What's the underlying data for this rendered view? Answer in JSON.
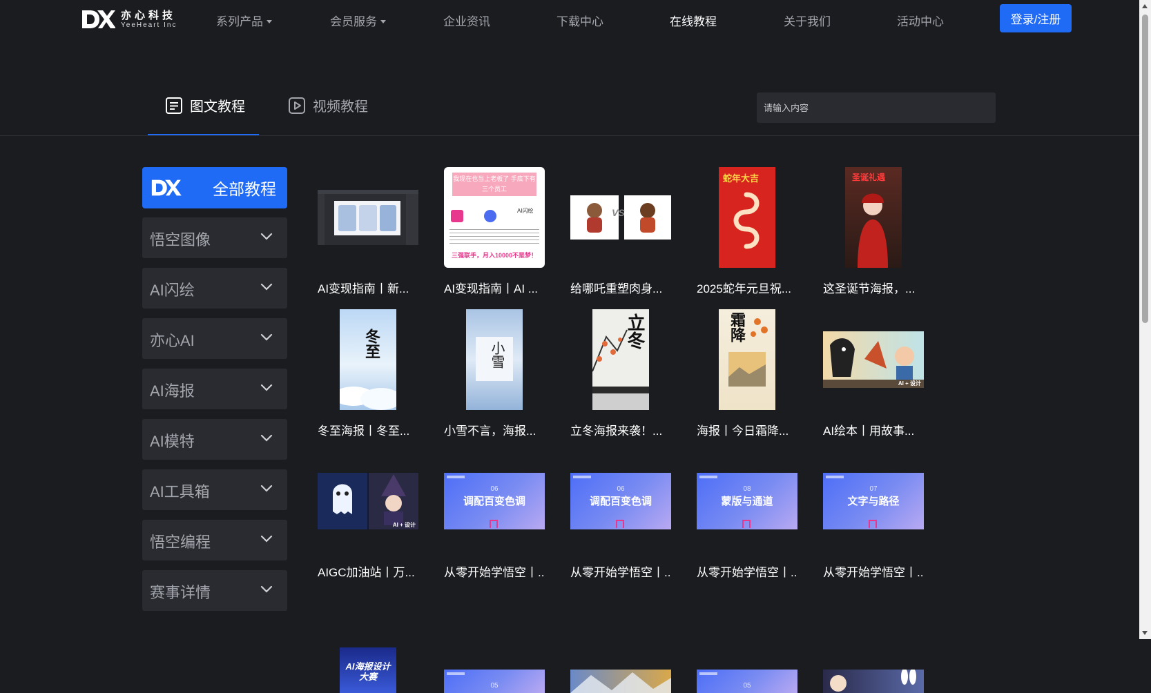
{
  "header": {
    "logo_cn": "亦心科技",
    "logo_en": "YeeHeart Inc",
    "nav": [
      {
        "label": "系列产品",
        "dropdown": true
      },
      {
        "label": "会员服务",
        "dropdown": true
      },
      {
        "label": "企业资讯",
        "dropdown": false
      },
      {
        "label": "下载中心",
        "dropdown": false
      },
      {
        "label": "在线教程",
        "dropdown": false,
        "active": true
      },
      {
        "label": "关于我们",
        "dropdown": false
      },
      {
        "label": "活动中心",
        "dropdown": false
      }
    ],
    "login_label": "登录/注册"
  },
  "tabs": [
    {
      "label": "图文教程",
      "icon": "article-icon",
      "active": true
    },
    {
      "label": "视频教程",
      "icon": "video-icon",
      "active": false
    }
  ],
  "search": {
    "placeholder": "请输入内容"
  },
  "sidebar": {
    "all_label": "全部教程",
    "items": [
      {
        "label": "悟空图像"
      },
      {
        "label": "AI闪绘"
      },
      {
        "label": "亦心AI"
      },
      {
        "label": "AI海报"
      },
      {
        "label": "AI模特"
      },
      {
        "label": "AI工具箱"
      },
      {
        "label": "悟空编程"
      },
      {
        "label": "赛事详情"
      }
    ]
  },
  "cards": [
    {
      "caption": "AI变现指南丨新...",
      "kind": "software"
    },
    {
      "caption": "AI变现指南丨AI ...",
      "kind": "guide",
      "thumb_title": "我现在也当上老板了 手底下有三个员工",
      "thumb_footer": "三强联手，月入10000不是梦！",
      "thumb_label": "AI闪绘"
    },
    {
      "caption": "给哪吒重塑肉身...",
      "kind": "versus",
      "thumb_text": "VS"
    },
    {
      "caption": "2025蛇年元旦祝...",
      "kind": "snake",
      "thumb_text": "蛇年大吉"
    },
    {
      "caption": "这圣诞节海报，...",
      "kind": "christmas",
      "thumb_text": "圣诞礼遇"
    },
    {
      "caption": "冬至海报丨冬至...",
      "kind": "winter",
      "thumb_text": "冬至"
    },
    {
      "caption": "小雪不言，海报...",
      "kind": "snow",
      "thumb_text": "小雪"
    },
    {
      "caption": "立冬海报来袭！...",
      "kind": "lidong",
      "thumb_text": "立冬"
    },
    {
      "caption": "海报丨今日霜降...",
      "kind": "frost",
      "thumb_text": "霜降"
    },
    {
      "caption": "AI绘本丨用故事...",
      "kind": "storybook",
      "thumb_text": "AI + 设计"
    },
    {
      "caption": "AIGC加油站丨万...",
      "kind": "aigc",
      "thumb_text": "AI + 设计"
    },
    {
      "caption": "从零开始学悟空丨...",
      "kind": "lesson",
      "num": "06",
      "title": "调配百变色调"
    },
    {
      "caption": "从零开始学悟空丨...",
      "kind": "lesson",
      "num": "06",
      "title": "调配百变色调"
    },
    {
      "caption": "从零开始学悟空丨...",
      "kind": "lesson",
      "num": "08",
      "title": "蒙版与通道"
    },
    {
      "caption": "从零开始学悟空丨...",
      "kind": "lesson",
      "num": "07",
      "title": "文字与路径"
    },
    {
      "caption": "",
      "kind": "contest",
      "thumb_text": "AI海报设计大赛"
    },
    {
      "caption": "",
      "kind": "lesson",
      "num": "05",
      "title": ""
    },
    {
      "caption": "",
      "kind": "landscape"
    },
    {
      "caption": "",
      "kind": "lesson",
      "num": "05",
      "title": ""
    },
    {
      "caption": "",
      "kind": "rabbit"
    }
  ],
  "colors": {
    "accent": "#1f6bf5",
    "background": "#1b1c20",
    "panel": "#2a2b31"
  }
}
